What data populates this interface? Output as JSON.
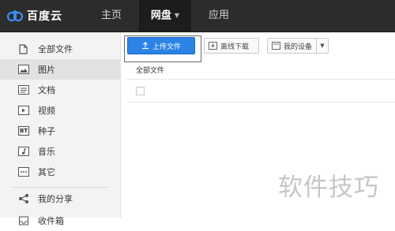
{
  "brand": {
    "name": "百度云"
  },
  "nav": {
    "home": "主页",
    "disk": "网盘",
    "apps": "应用"
  },
  "sidebar": {
    "items": [
      {
        "label": "全部文件",
        "icon": "file-icon",
        "active": false
      },
      {
        "label": "图片",
        "icon": "image-icon",
        "active": true
      },
      {
        "label": "文档",
        "icon": "document-icon",
        "active": false
      },
      {
        "label": "视频",
        "icon": "video-icon",
        "active": false
      },
      {
        "label": "种子",
        "icon": "bt-icon",
        "badge": "BT",
        "active": false
      },
      {
        "label": "音乐",
        "icon": "music-icon",
        "active": false
      },
      {
        "label": "其它",
        "icon": "more-icon",
        "active": false
      }
    ],
    "share": {
      "label": "我的分享",
      "icon": "share-icon"
    },
    "partial": {
      "label": "收件箱"
    }
  },
  "toolbar": {
    "upload_label": "上传文件",
    "offline_label": "离线下载",
    "device_label": "我的设备"
  },
  "content": {
    "breadcrumb": "全部文件"
  },
  "watermark": "软件技巧",
  "colors": {
    "topbar": "#2c2c2c",
    "accent": "#2a83e5",
    "sidebar": "#f3f3f3"
  }
}
